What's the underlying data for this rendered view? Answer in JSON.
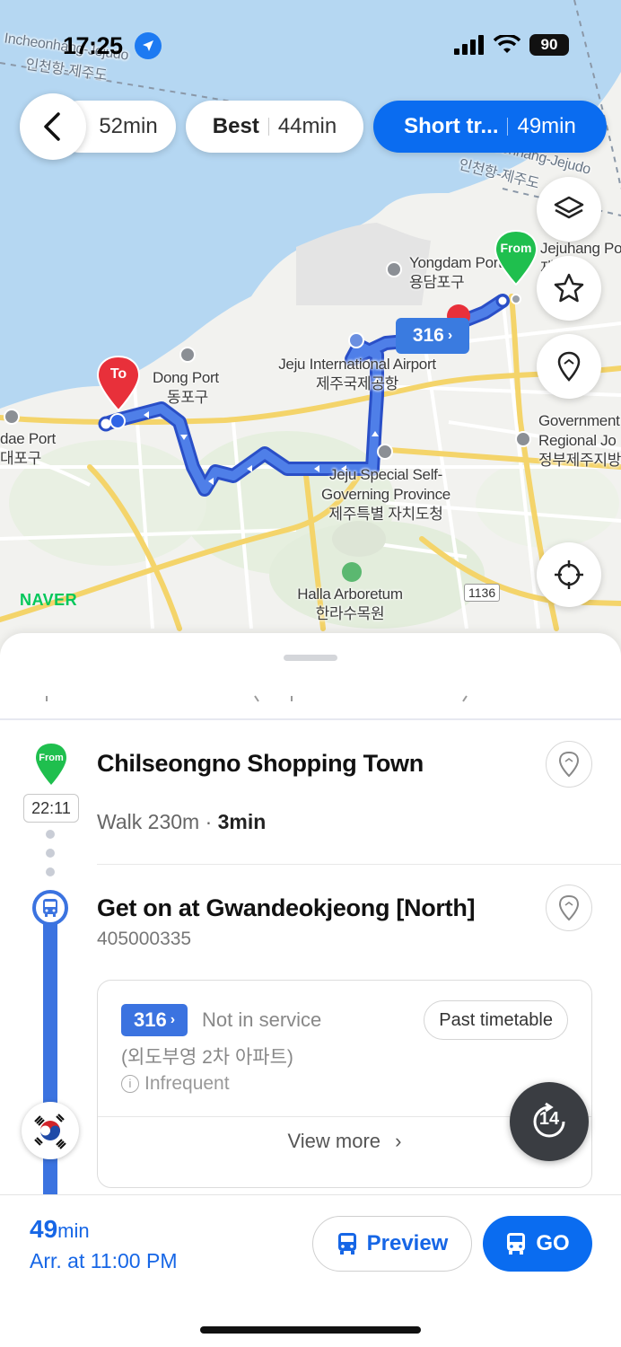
{
  "status_bar": {
    "time": "17:25",
    "battery": "90"
  },
  "routes": [
    {
      "label": "",
      "time": "52min",
      "active": false
    },
    {
      "label": "Best",
      "time": "44min",
      "active": false
    },
    {
      "label": "Short tr...",
      "time": "49min",
      "active": true
    }
  ],
  "map": {
    "labels": {
      "incheon_en": "Incheonhang-Jejudo",
      "incheon_ko": "인천항-제주도",
      "incheon_right_en": "Incheonhang-Jejudo",
      "incheon_right_ko": "인천항-제주도",
      "yongdam_en": "Yongdam Port",
      "yongdam_ko": "용담포구",
      "jejuhang_en": "Jejuhang Port",
      "jejuhang_ko": "제주항",
      "airport_en": "Jeju International Airport",
      "airport_ko": "제주국제공항",
      "dong_en": "Dong Port",
      "dong_ko": "동포구",
      "dae_en": "dae Port",
      "dae_ko": "대포구",
      "gov_en": "Governing Province",
      "gov_ko": "제주특별 자치도청",
      "self_en": "Jeju Special Self-",
      "govt_right_1": "Government",
      "govt_right_2": "Regional Jo",
      "govt_right_3": "정부제주지방",
      "halla_en": "Halla Arboretum",
      "halla_ko": "한라수목원",
      "road": "1136"
    },
    "pin_from": "From",
    "pin_to": "To",
    "bus_tag": "316",
    "brand": "NAVER"
  },
  "steps": {
    "from_pin": "From",
    "depart_time": "22:11",
    "origin_name": "Chilseongno Shopping Town",
    "walk_label": "Walk 230m",
    "walk_time": "3min",
    "board_title": "Get on at Gwandeokjeong [North]",
    "stop_id": "405000335"
  },
  "bus_card": {
    "route": "316",
    "status": "Not in service",
    "timetable_button": "Past timetable",
    "destination": "(외도부영 2차 아파트)",
    "frequency": "Infrequent",
    "view_more": "View more"
  },
  "refresh_badge": "14",
  "summary": {
    "total_value": "49",
    "total_unit": "min",
    "arrival": "Arr. at 11:00 PM",
    "preview_label": "Preview",
    "go_label": "GO"
  },
  "colors": {
    "primary": "#0a6cf0",
    "route": "#3b73e0",
    "from_green": "#1fbf4e",
    "to_red": "#e8303a"
  }
}
